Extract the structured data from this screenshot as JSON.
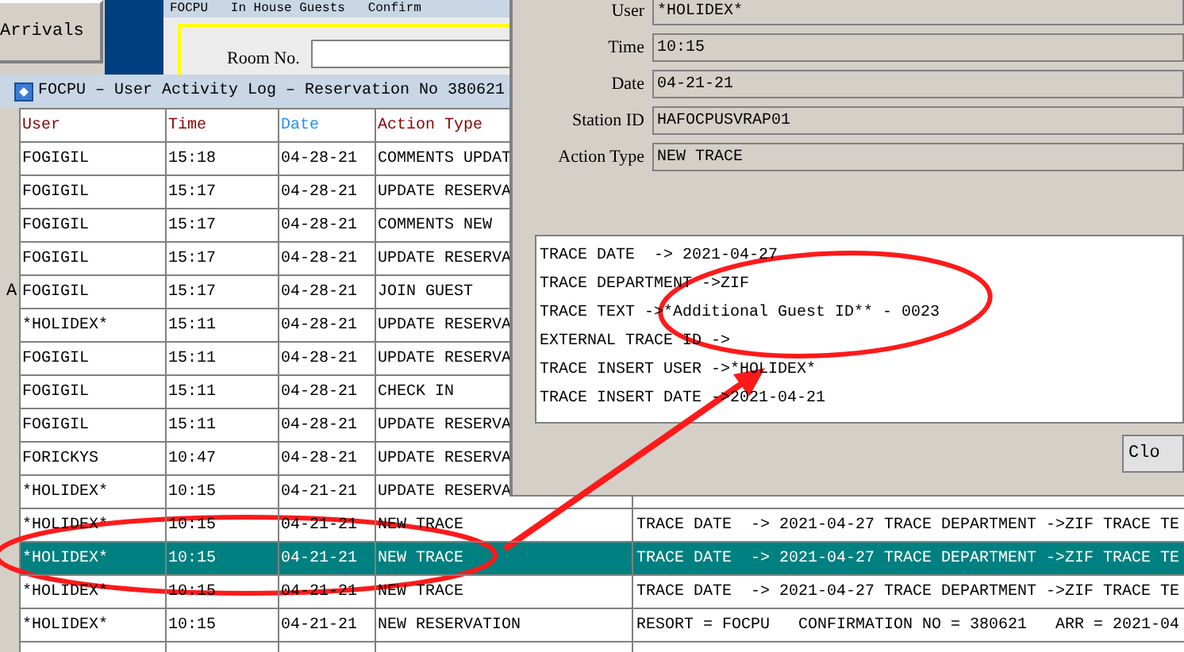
{
  "background": {
    "button": "Arrivals"
  },
  "guest_window": {
    "title": "FOCPU   In House Guests   Confirm",
    "room_label": "Room No."
  },
  "log_window": {
    "title": "FOCPU – User Activity Log – Reservation No 380621",
    "side_label": "A",
    "columns": [
      {
        "label": "User",
        "sorted": false
      },
      {
        "label": "Time",
        "sorted": false
      },
      {
        "label": "Date",
        "sorted": true
      },
      {
        "label": "Action Type",
        "sorted": false
      }
    ],
    "rows": [
      {
        "user": "FOGIGIL",
        "time": "15:18",
        "date": "04-28-21",
        "action": "COMMENTS UPDAT",
        "selected": false
      },
      {
        "user": "FOGIGIL",
        "time": "15:17",
        "date": "04-28-21",
        "action": "UPDATE RESERVA",
        "selected": false
      },
      {
        "user": "FOGIGIL",
        "time": "15:17",
        "date": "04-28-21",
        "action": "COMMENTS NEW",
        "selected": false
      },
      {
        "user": "FOGIGIL",
        "time": "15:17",
        "date": "04-28-21",
        "action": "UPDATE RESERVA",
        "selected": false
      },
      {
        "user": "FOGIGIL",
        "time": "15:17",
        "date": "04-28-21",
        "action": "JOIN GUEST",
        "selected": false
      },
      {
        "user": "*HOLIDEX*",
        "time": "15:11",
        "date": "04-28-21",
        "action": "UPDATE RESERVA",
        "selected": false
      },
      {
        "user": "FOGIGIL",
        "time": "15:11",
        "date": "04-28-21",
        "action": "UPDATE RESERVA",
        "selected": false
      },
      {
        "user": "FOGIGIL",
        "time": "15:11",
        "date": "04-28-21",
        "action": "CHECK IN",
        "selected": false
      },
      {
        "user": "FOGIGIL",
        "time": "15:11",
        "date": "04-28-21",
        "action": "UPDATE RESERVA",
        "selected": false
      },
      {
        "user": "FORICKYS",
        "time": "10:47",
        "date": "04-28-21",
        "action": "UPDATE RESERVA",
        "selected": false
      },
      {
        "user": "*HOLIDEX*",
        "time": "10:15",
        "date": "04-21-21",
        "action": "UPDATE RESERVA",
        "selected": false
      },
      {
        "user": "*HOLIDEX*",
        "time": "10:15",
        "date": "04-21-21",
        "action": "NEW TRACE",
        "details": "TRACE DATE  -> 2021-04-27 TRACE DEPARTMENT ->ZIF TRACE TE",
        "selected": false
      },
      {
        "user": "*HOLIDEX*",
        "time": "10:15",
        "date": "04-21-21",
        "action": "NEW TRACE",
        "details": "TRACE DATE  -> 2021-04-27 TRACE DEPARTMENT ->ZIF TRACE TE",
        "selected": true
      },
      {
        "user": "*HOLIDEX*",
        "time": "10:15",
        "date": "04-21-21",
        "action": "NEW TRACE",
        "details": "TRACE DATE  -> 2021-04-27 TRACE DEPARTMENT ->ZIF TRACE TE",
        "selected": false
      },
      {
        "user": "*HOLIDEX*",
        "time": "10:15",
        "date": "04-21-21",
        "action": "NEW RESERVATION",
        "details": "RESORT = FOCPU   CONFIRMATION NO = 380621   ARR = 2021-04",
        "selected": false
      }
    ]
  },
  "detail_window": {
    "fields": [
      {
        "label": "User",
        "value": "*HOLIDEX*"
      },
      {
        "label": "Time",
        "value": "10:15"
      },
      {
        "label": "Date",
        "value": "04-21-21"
      },
      {
        "label": "Station ID",
        "value": "HAFOCPUSVRAP01"
      },
      {
        "label": "Action Type",
        "value": "NEW TRACE"
      }
    ],
    "trace_lines": [
      "TRACE DATE  -> 2021-04-27",
      "TRACE DEPARTMENT ->ZIF",
      "TRACE TEXT ->*Additional Guest ID** - 0023",
      "EXTERNAL TRACE ID ->",
      "TRACE INSERT USER ->*HOLIDEX*",
      "TRACE INSERT DATE ->2021-04-21"
    ],
    "close_button": "Clo"
  }
}
